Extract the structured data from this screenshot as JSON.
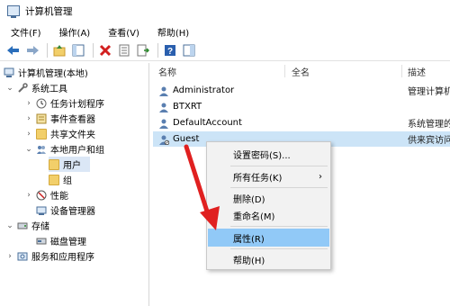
{
  "window": {
    "title": "计算机管理"
  },
  "menubar": {
    "items": [
      "文件(F)",
      "操作(A)",
      "查看(V)",
      "帮助(H)"
    ]
  },
  "tree": {
    "root": "计算机管理(本地)",
    "system_tools": "系统工具",
    "task_scheduler": "任务计划程序",
    "event_viewer": "事件查看器",
    "shared_folders": "共享文件夹",
    "local_users": "本地用户和组",
    "users": "用户",
    "groups": "组",
    "performance": "性能",
    "device_manager": "设备管理器",
    "storage": "存储",
    "disk_management": "磁盘管理",
    "services": "服务和应用程序"
  },
  "list": {
    "columns": [
      "名称",
      "全名",
      "描述"
    ],
    "rows": [
      {
        "name": "Administrator",
        "fullname": "",
        "desc": "管理计算机(域)的"
      },
      {
        "name": "BTXRT",
        "fullname": "",
        "desc": ""
      },
      {
        "name": "DefaultAccount",
        "fullname": "",
        "desc": "系统管理的用户帐户"
      },
      {
        "name": "Guest",
        "fullname": "",
        "desc": "供来宾访问计算机"
      }
    ]
  },
  "context_menu": {
    "set_password": "设置密码(S)...",
    "all_tasks": "所有任务(K)",
    "delete": "删除(D)",
    "rename": "重命名(M)",
    "properties": "属性(R)",
    "help": "帮助(H)",
    "submenu_arrow": "›"
  },
  "colors": {
    "selection": "#cce4f7",
    "menu_hover": "#91c9f7",
    "annotation_arrow": "#e02020"
  }
}
